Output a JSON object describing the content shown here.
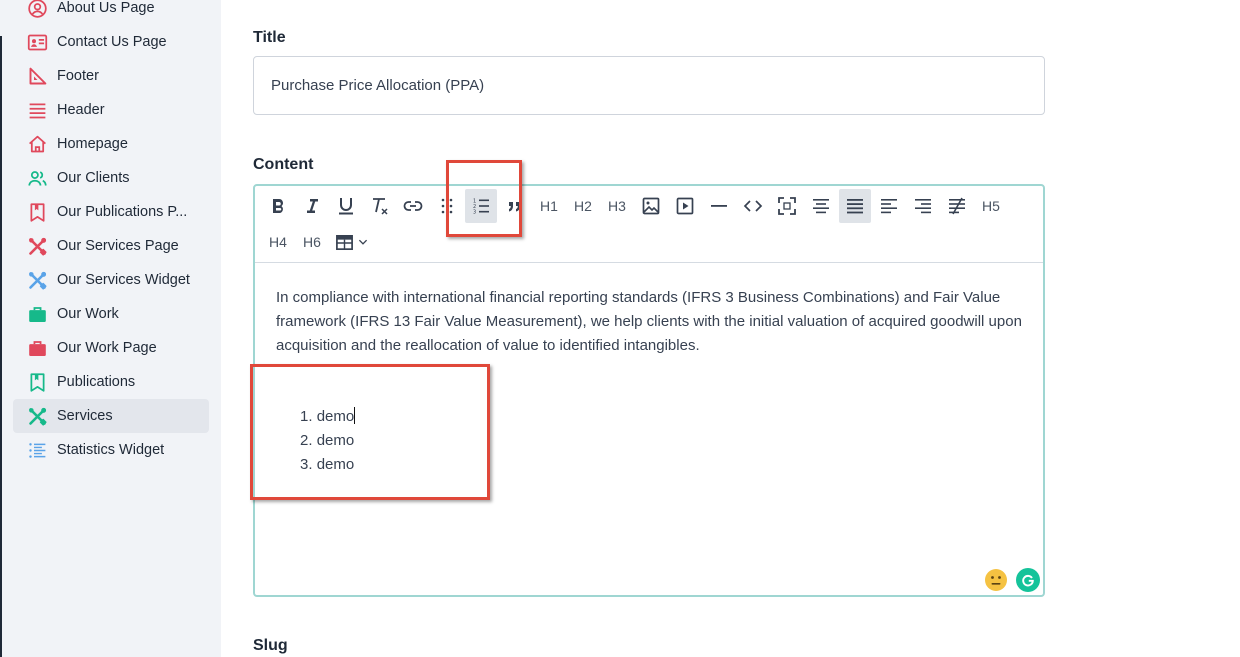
{
  "sidebar": {
    "items": [
      {
        "label": "About Us Page",
        "icon": "user-circle-icon",
        "color": "#e0485c"
      },
      {
        "label": "Contact Us Page",
        "icon": "contact-card-icon",
        "color": "#e0485c"
      },
      {
        "label": "Footer",
        "icon": "ruler-triangle-icon",
        "color": "#e0485c"
      },
      {
        "label": "Header",
        "icon": "menu-lines-icon",
        "color": "#e0485c"
      },
      {
        "label": "Homepage",
        "icon": "home-icon",
        "color": "#e0485c"
      },
      {
        "label": "Our Clients",
        "icon": "users-icon",
        "color": "#16b98a"
      },
      {
        "label": "Our Publications P...",
        "icon": "bookmark-icon",
        "color": "#e0485c"
      },
      {
        "label": "Our Services Page",
        "icon": "tools-icon",
        "color": "#e0485c"
      },
      {
        "label": "Our Services Widget",
        "icon": "tools-icon",
        "color": "#5aa3e8"
      },
      {
        "label": "Our Work",
        "icon": "briefcase-icon",
        "color": "#16b98a"
      },
      {
        "label": "Our Work Page",
        "icon": "briefcase-icon",
        "color": "#e0485c"
      },
      {
        "label": "Publications",
        "icon": "bookmark-icon",
        "color": "#16b98a"
      },
      {
        "label": "Services",
        "icon": "tools-icon",
        "color": "#16b98a",
        "active": true
      },
      {
        "label": "Statistics Widget",
        "icon": "list-icon",
        "color": "#5aa3e8"
      }
    ]
  },
  "form": {
    "title_label": "Title",
    "title_value": "Purchase Price Allocation (PPA)",
    "content_label": "Content",
    "slug_label": "Slug"
  },
  "toolbar": {
    "h1": "H1",
    "h2": "H2",
    "h3": "H3",
    "h4": "H4",
    "h5": "H5",
    "h6": "H6"
  },
  "editor": {
    "paragraph": "In compliance with international financial reporting standards (IFRS 3 Business Combinations) and Fair Value framework (IFRS 13 Fair Value Measurement), we help clients with the initial valuation of acquired goodwill upon acquisition and the reallocation of value to identified intangibles.",
    "list_items": [
      "demo",
      "demo",
      "demo"
    ]
  },
  "colors": {
    "accent_border": "#9fd6d2",
    "highlight": "#e0483a",
    "grammarly": "#15c39a"
  }
}
